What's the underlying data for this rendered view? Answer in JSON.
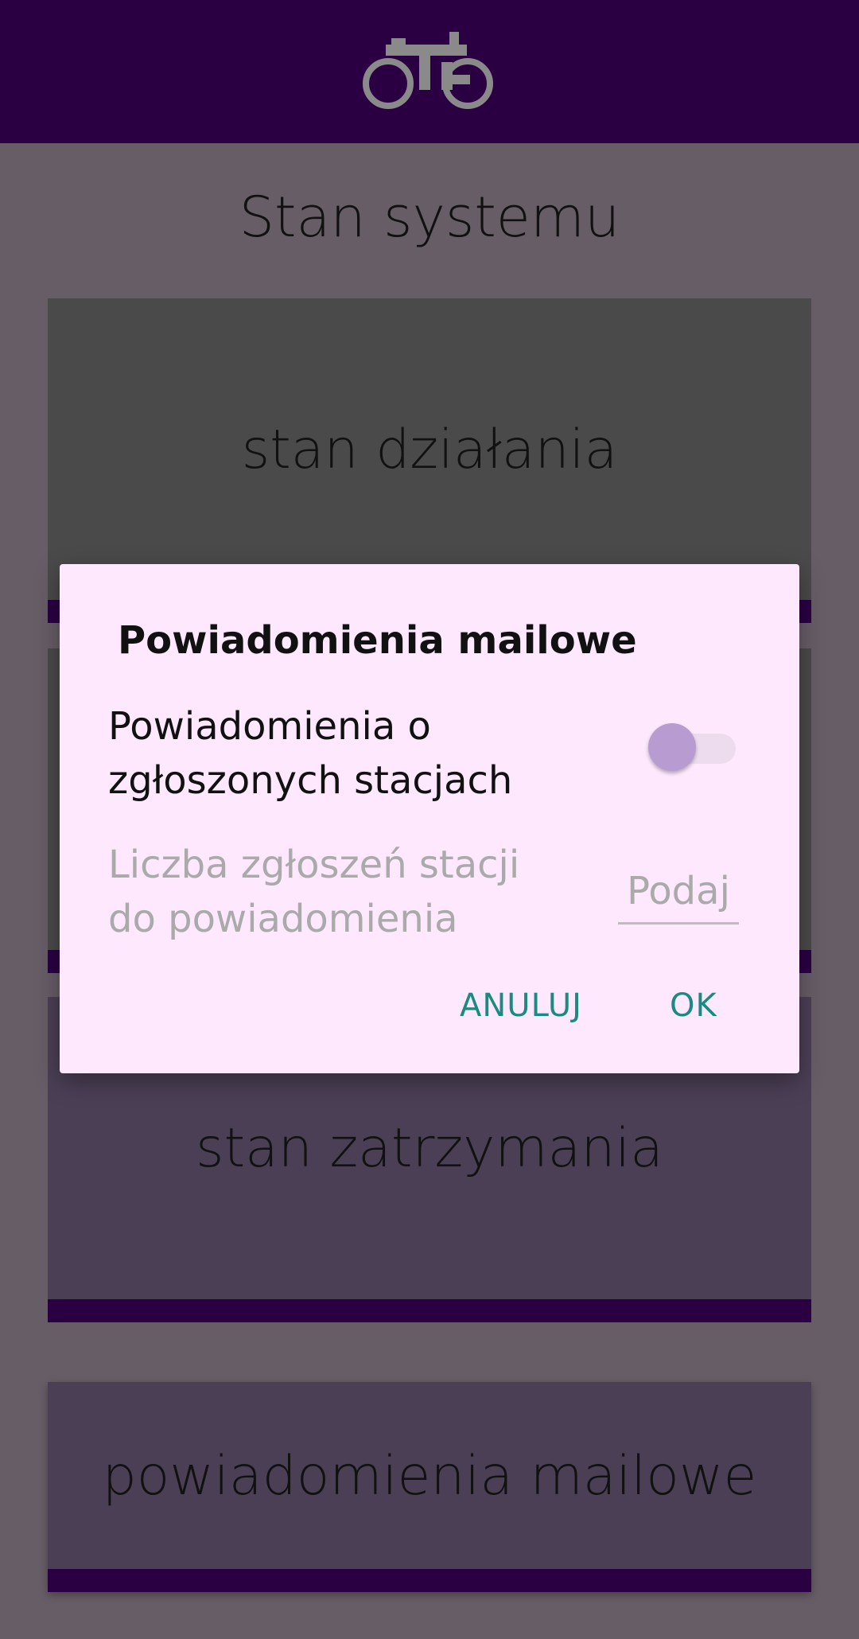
{
  "app": {
    "logo_icon": "bicycle-icon"
  },
  "page": {
    "title": "Stan systemu"
  },
  "cards": [
    {
      "label": "stan działania"
    },
    {
      "label": ""
    },
    {
      "label": "stan zatrzymania"
    },
    {
      "label": "powiadomienia mailowe"
    }
  ],
  "dialog": {
    "title": "Powiadomienia mailowe",
    "notify_label": "Powiadomienia o zgłoszonych stacjach",
    "notify_enabled": false,
    "count_label": "Liczba zgłoszeń stacji do powiadomienia",
    "count_value": "",
    "count_placeholder": "Podaj",
    "cancel_label": "ANULUJ",
    "ok_label": "OK"
  },
  "colors": {
    "header": "#2a0043",
    "accent": "#1b8a80",
    "dialog_bg": "#fde8fd",
    "switch_thumb": "#b89cd1"
  }
}
